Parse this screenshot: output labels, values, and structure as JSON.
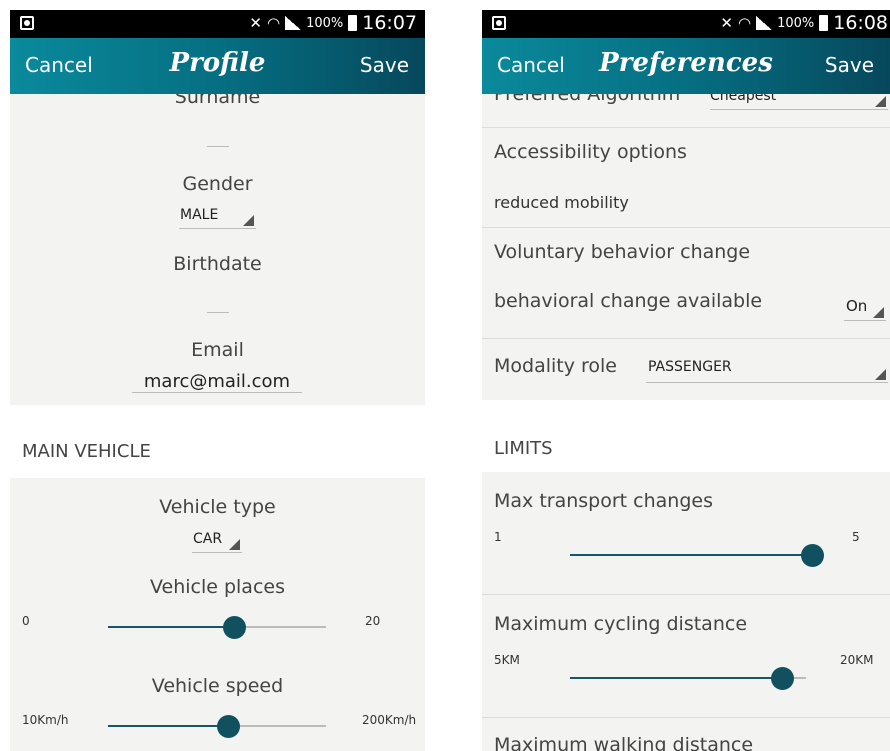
{
  "left": {
    "status": {
      "battery_pct": "100%",
      "time": "16:07"
    },
    "appbar": {
      "cancel": "Cancel",
      "title": "Profile",
      "save": "Save"
    },
    "fields": {
      "surname_label": "Surname",
      "surname_value": "",
      "gender_label": "Gender",
      "gender_value": "MALE",
      "birthdate_label": "Birthdate",
      "birthdate_value": "",
      "email_label": "Email",
      "email_value": "marc@mail.com"
    },
    "main_vehicle": {
      "header": "MAIN VEHICLE",
      "type_label": "Vehicle type",
      "type_value": "CAR",
      "places_label": "Vehicle places",
      "places_min": "0",
      "places_max": "20",
      "places_level": 0.58,
      "speed_label": "Vehicle speed",
      "speed_min": "10Km/h",
      "speed_max": "200Km/h",
      "speed_level": 0.55
    }
  },
  "right": {
    "status": {
      "battery_pct": "100%",
      "time": "16:08"
    },
    "appbar": {
      "cancel": "Cancel",
      "title": "Preferences",
      "save": "Save"
    },
    "preferred_algorithm": {
      "label": "Preferred Algorithm",
      "value": "Cheapest"
    },
    "accessibility": {
      "label": "Accessibility options",
      "value": "reduced mobility"
    },
    "voluntary": {
      "label": "Voluntary behavior change",
      "sub_label": "behavioral change available",
      "value": "On"
    },
    "modality": {
      "label": "Modality role",
      "value": "PASSENGER"
    },
    "limits": {
      "header": "LIMITS",
      "transport": {
        "label": "Max transport changes",
        "min": "1",
        "max": "5",
        "level": 1.0
      },
      "cycling": {
        "label": "Maximum cycling distance",
        "min": "5KM",
        "max": "20KM",
        "level": 0.9
      },
      "walking": {
        "label": "Maximum walking distance"
      }
    }
  },
  "colors": {
    "appbar_start": "#0a8a9c",
    "appbar_end": "#07485c",
    "accent": "#10505f",
    "panel": "#f3f3f1"
  },
  "icons": [
    "notification-icon",
    "mute-icon",
    "wifi-icon",
    "signal-icon",
    "battery-icon",
    "dropdown-triangle-icon"
  ]
}
